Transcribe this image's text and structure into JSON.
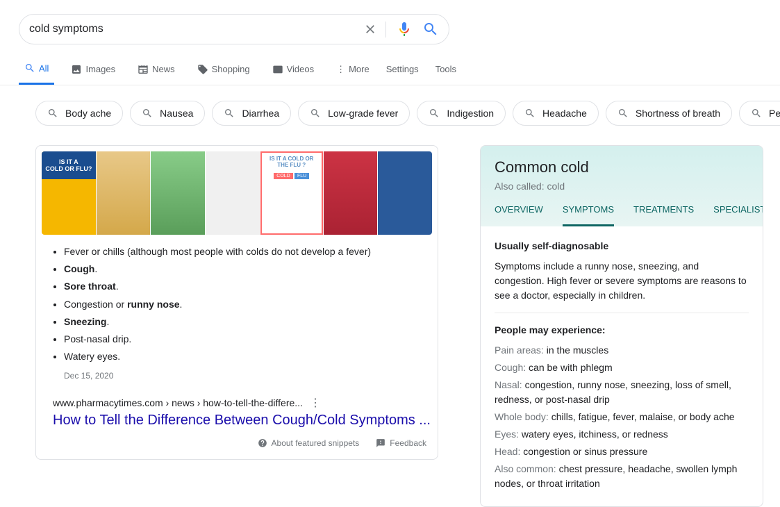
{
  "search": {
    "query": "cold symptoms"
  },
  "tabs": [
    "All",
    "Images",
    "News",
    "Shopping",
    "Videos",
    "More"
  ],
  "tabs_right": [
    "Settings",
    "Tools"
  ],
  "chips": [
    "Body ache",
    "Nausea",
    "Diarrhea",
    "Low-grade fever",
    "Indigestion",
    "Headache",
    "Shortness of breath",
    "Persistent"
  ],
  "thumbs": {
    "t1": "IS IT A",
    "t1b": "COLD OR FLU?",
    "t5": "IS IT A COLD OR THE  FLU ?",
    "t5a": "COLD",
    "t5b": "FLU"
  },
  "snippet": {
    "items": [
      {
        "pre": "Fever or chills (although most people with colds do not develop a fever)",
        "bold": ""
      },
      {
        "pre": "",
        "bold": "Cough",
        "suf": "."
      },
      {
        "pre": "",
        "bold": "Sore throat",
        "suf": "."
      },
      {
        "pre": "Congestion or ",
        "bold": "runny nose",
        "suf": "."
      },
      {
        "pre": "",
        "bold": "Sneezing",
        "suf": "."
      },
      {
        "pre": "Post-nasal drip.",
        "bold": ""
      },
      {
        "pre": "Watery eyes.",
        "bold": ""
      }
    ],
    "date": "Dec 15, 2020",
    "cite": "www.pharmacytimes.com › news › how-to-tell-the-differe...",
    "title": "How to Tell the Difference Between Cough/Cold Symptoms ..."
  },
  "footer": {
    "about": "About featured snippets",
    "feedback": "Feedback"
  },
  "kp": {
    "title": "Common cold",
    "sub_label": "Also called:",
    "sub_val": "cold",
    "tabs": [
      "OVERVIEW",
      "SYMPTOMS",
      "TREATMENTS",
      "SPECIALISTS"
    ],
    "diag_title": "Usually self-diagnosable",
    "diag_desc": "Symptoms include a runny nose, sneezing, and congestion. High fever or severe symptoms are reasons to see a doctor, especially in children.",
    "exp_title": "People may experience:",
    "symptoms": [
      {
        "label": "Pain areas:",
        "val": " in the muscles"
      },
      {
        "label": "Cough:",
        "val": " can be with phlegm"
      },
      {
        "label": "Nasal:",
        "val": " congestion, runny nose, sneezing, loss of smell, redness, or post-nasal drip"
      },
      {
        "label": "Whole body:",
        "val": " chills, fatigue, fever, malaise, or body ache"
      },
      {
        "label": "Eyes:",
        "val": " watery eyes, itchiness, or redness"
      },
      {
        "label": "Head:",
        "val": " congestion or sinus pressure"
      },
      {
        "label": "Also common:",
        "val": " chest pressure, headache, swollen lymph nodes, or throat irritation"
      }
    ]
  }
}
